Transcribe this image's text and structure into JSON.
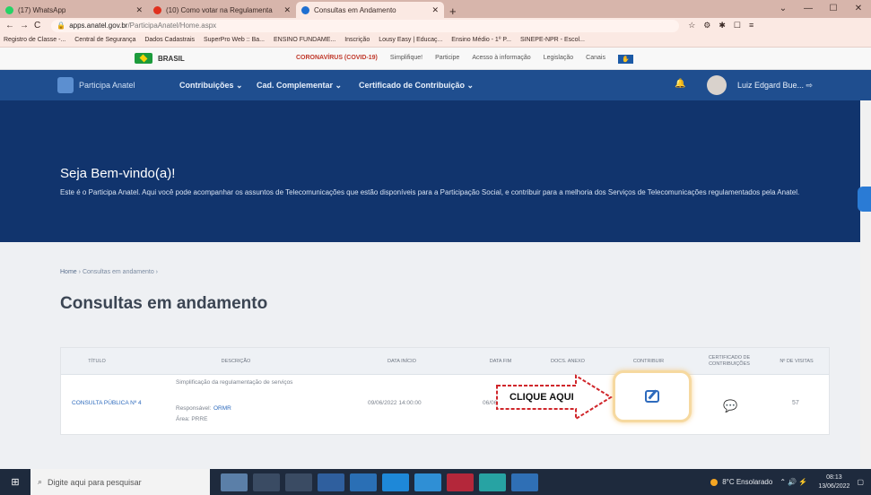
{
  "browser": {
    "tabs": [
      {
        "title": "(17) WhatsApp",
        "fav_color": "#25d366"
      },
      {
        "title": "(10) Como votar na Regulamenta",
        "fav_color": "#e0301e"
      },
      {
        "title": "Consultas em Andamento",
        "fav_color": "#1f6fd1"
      }
    ],
    "url_host": "apps.anatel.gov.br",
    "url_path": "/ParticipaAnatel/Home.aspx",
    "bookmarks": [
      "Registro de Classe -...",
      "Central de Segurança",
      "Dados Cadastrais",
      "SuperPro Web :: Ba...",
      "ENSINO FUNDAME...",
      "Inscrição",
      "Lousy Easy | Educaç...",
      "Ensino Médio - 1º P...",
      "SINEPE-NPR - Escol..."
    ]
  },
  "govbar": {
    "brasil": "BRASIL",
    "links": [
      "CORONAVÍRUS (COVID-19)",
      "Simplifique!",
      "Participe",
      "Acesso à informação",
      "Legislação",
      "Canais"
    ]
  },
  "nav": {
    "brand": "Participa Anatel",
    "menu": [
      "Contribuições ⌄",
      "Cad. Complementar ⌄",
      "Certificado de Contribuição ⌄"
    ],
    "user": "Luiz Edgard Bue... ⇨"
  },
  "hero": {
    "title": "Seja Bem-vindo(a)!",
    "text": "Este é o Participa Anatel. Aqui você pode acompanhar os assuntos de Telecomunicações que estão disponíveis para a Participação Social, e contribuir para a melhoria dos Serviços de Telecomunicações regulamentados pela Anatel."
  },
  "breadcrumb": {
    "home": "Home",
    "sep": "›",
    "current": "Consultas em andamento",
    "sep2": "›"
  },
  "page_title": "Consultas em andamento",
  "table": {
    "headers": [
      "TÍTULO",
      "DESCRIÇÃO",
      "DATA INÍCIO",
      "DATA FIM",
      "DOCS. ANEXO",
      "CONTRIBUIR",
      "CERTIFICADO DE CONTRIBUIÇÕES",
      "Nº DE VISITAS"
    ],
    "row": {
      "titulo": "CONSULTA PÚBLICA Nº 4",
      "desc1": "Simplificação da regulamentação de serviços",
      "desc2_label": "Responsável:",
      "desc2_value": "ORMR",
      "desc3": "Área: PRRE",
      "inicio": "09/06/2022 14:00:00",
      "fim": "06/06",
      "visitas": "57"
    }
  },
  "callout": {
    "label": "CLIQUE  AQUI"
  },
  "taskbar": {
    "search_placeholder": "Digite aqui para pesquisar",
    "weather": "8°C  Ensolarado",
    "time": "08:13",
    "date": "13/06/2022"
  }
}
